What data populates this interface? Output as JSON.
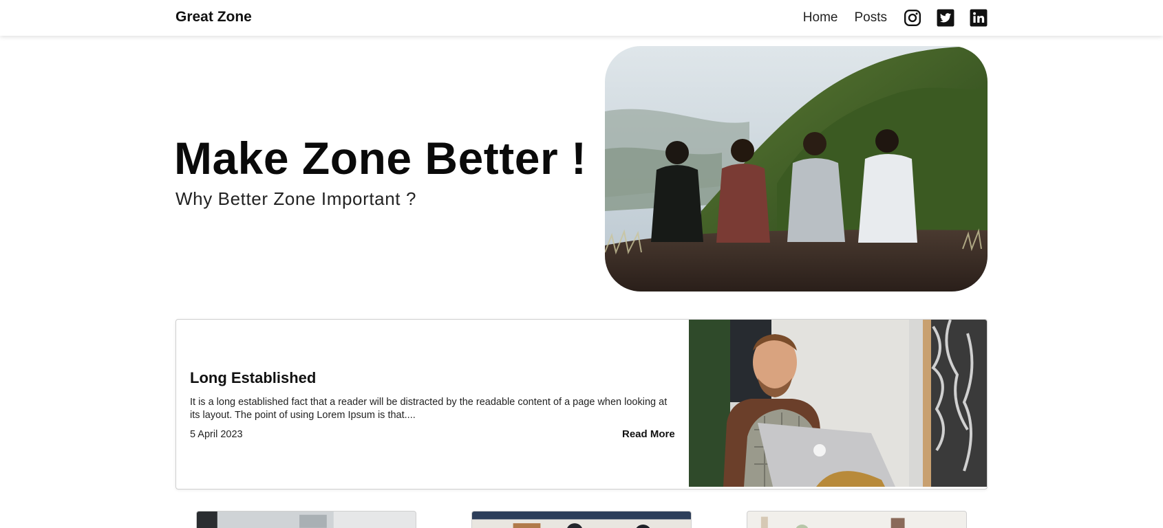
{
  "navbar": {
    "brand": "Great Zone",
    "links": [
      "Home",
      "Posts"
    ],
    "icons": [
      "instagram-icon",
      "twitter-icon",
      "linkedin-icon"
    ]
  },
  "hero": {
    "title": "Make Zone Better !",
    "subtitle": "Why Better Zone Important ?"
  },
  "featured_post": {
    "title": "Long Established",
    "excerpt": "It is a long established fact that a reader will be distracted by the readable content of a page when looking at its layout. The point of using Lorem Ipsum is that....",
    "date": "5 April 2023",
    "read_more": "Read More"
  },
  "colors": {
    "text": "#111111",
    "background": "#ffffff",
    "border": "#cfcfcf"
  }
}
